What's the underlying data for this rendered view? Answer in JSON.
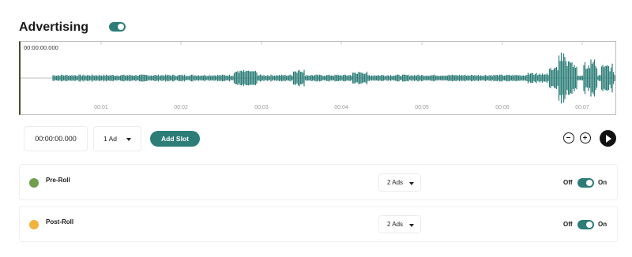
{
  "header": {
    "title": "Advertising",
    "toggle_on": true
  },
  "waveform": {
    "timestamp": "00:00:00.000",
    "ticks": [
      "00:01",
      "00:02",
      "00:03",
      "00:04",
      "00:05",
      "00:06",
      "00:07"
    ]
  },
  "controls": {
    "time_value": "00:00:00.000",
    "ads_select": "1 Ad",
    "add_slot_label": "Add Slot",
    "zoom_out_icon": "minus-circle-icon",
    "zoom_in_icon": "plus-circle-icon",
    "play_icon": "play-icon"
  },
  "slots": [
    {
      "name": "Pre-Roll",
      "ads": "2 Ads",
      "off_label": "Off",
      "on_label": "On",
      "color": "#6e9e4e",
      "enabled": true
    },
    {
      "name": "Post-Roll",
      "ads": "2 Ads",
      "off_label": "Off",
      "on_label": "On",
      "color": "#f2b33d",
      "enabled": true
    }
  ],
  "colors": {
    "accent": "#2c7d78"
  }
}
